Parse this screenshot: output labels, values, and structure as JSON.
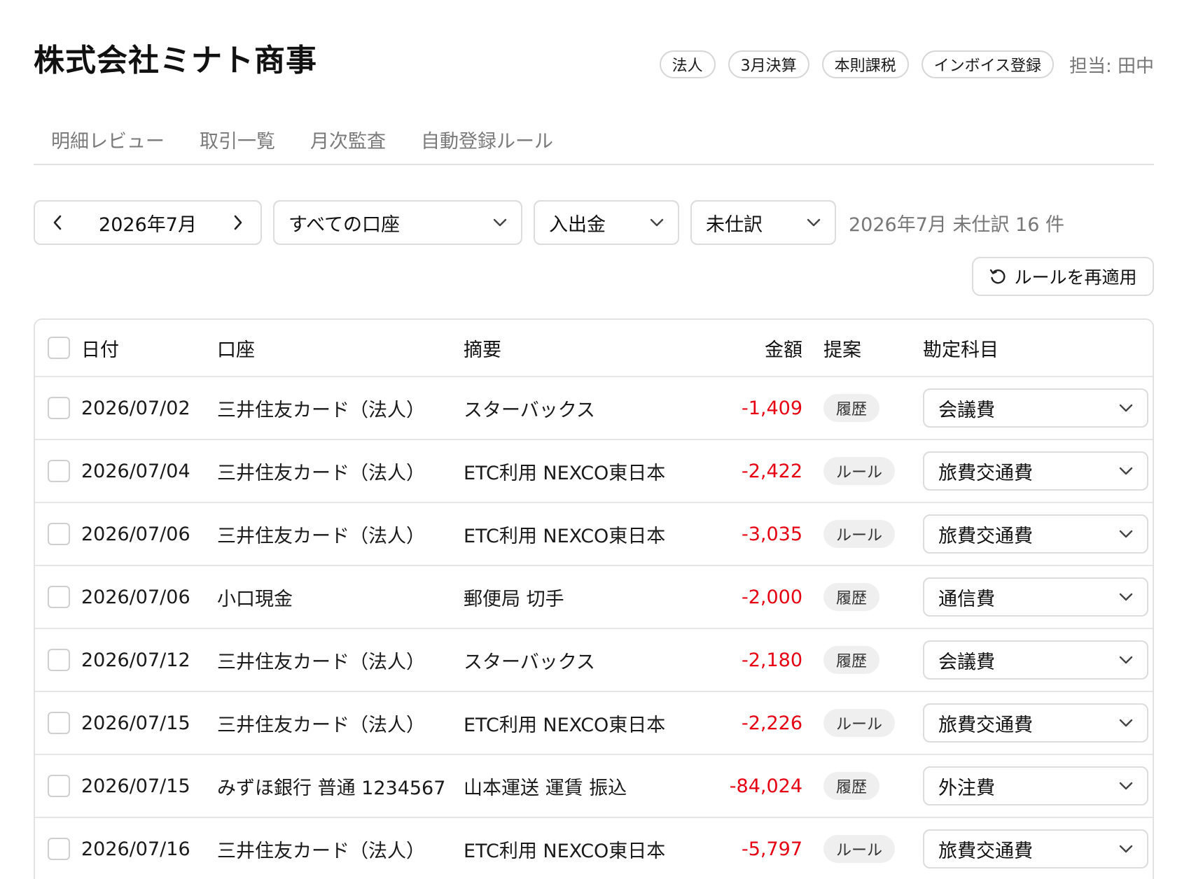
{
  "company": {
    "name": "株式会社ミナト商事"
  },
  "tags": [
    "法人",
    "3月決算",
    "本則課税",
    "インボイス登録"
  ],
  "owner": "担当: 田中",
  "tabs": [
    "明細レビュー",
    "取引一覧",
    "月次監査",
    "自動登録ルール"
  ],
  "filters": {
    "month": "2026年7月",
    "account": "すべての口座",
    "direction": "入出金",
    "status": "未仕訳",
    "summary": "2026年7月 未仕訳 16 件"
  },
  "actions": {
    "reapply_label": "ルールを再適用"
  },
  "table": {
    "headers": {
      "date": "日付",
      "account": "口座",
      "description": "摘要",
      "amount": "金額",
      "suggestion": "提案",
      "category": "勘定科目"
    },
    "rows": [
      {
        "date": "2026/07/02",
        "account": "三井住友カード（法人）",
        "description": "スターバックス",
        "amount": "-1,409",
        "suggestion": "履歴",
        "category": "会議費"
      },
      {
        "date": "2026/07/04",
        "account": "三井住友カード（法人）",
        "description": "ETC利用 NEXCO東日本",
        "amount": "-2,422",
        "suggestion": "ルール",
        "category": "旅費交通費"
      },
      {
        "date": "2026/07/06",
        "account": "三井住友カード（法人）",
        "description": "ETC利用 NEXCO東日本",
        "amount": "-3,035",
        "suggestion": "ルール",
        "category": "旅費交通費"
      },
      {
        "date": "2026/07/06",
        "account": "小口現金",
        "description": "郵便局 切手",
        "amount": "-2,000",
        "suggestion": "履歴",
        "category": "通信費"
      },
      {
        "date": "2026/07/12",
        "account": "三井住友カード（法人）",
        "description": "スターバックス",
        "amount": "-2,180",
        "suggestion": "履歴",
        "category": "会議費"
      },
      {
        "date": "2026/07/15",
        "account": "三井住友カード（法人）",
        "description": "ETC利用 NEXCO東日本",
        "amount": "-2,226",
        "suggestion": "ルール",
        "category": "旅費交通費"
      },
      {
        "date": "2026/07/15",
        "account": "みずほ銀行 普通 1234567",
        "description": "山本運送 運賃 振込",
        "amount": "-84,024",
        "suggestion": "履歴",
        "category": "外注費"
      },
      {
        "date": "2026/07/16",
        "account": "三井住友カード（法人）",
        "description": "ETC利用 NEXCO東日本",
        "amount": "-5,797",
        "suggestion": "ルール",
        "category": "旅費交通費"
      }
    ]
  },
  "colors": {
    "negative_amount": "#e60012",
    "badge_bg": "#efefef",
    "border": "#dcdcdc"
  },
  "icons": {
    "prev": "chevron-left-icon",
    "next": "chevron-right-icon",
    "dropdown": "chevron-down-icon",
    "reapply": "refresh-icon"
  }
}
